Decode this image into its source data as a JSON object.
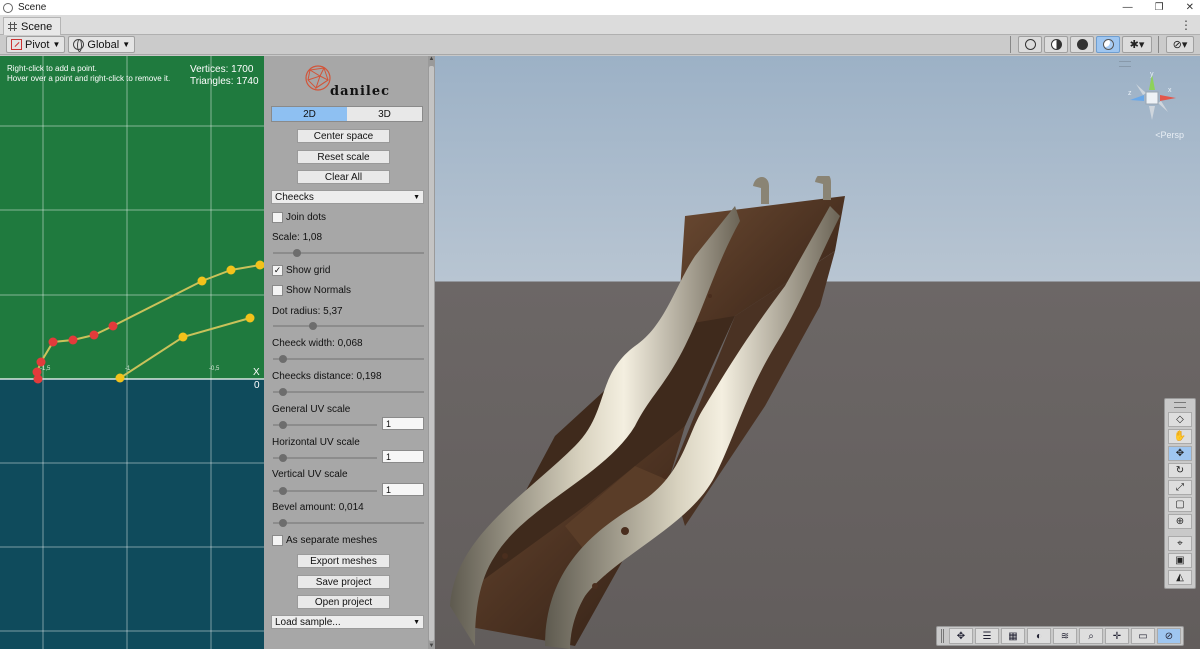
{
  "window": {
    "title": "Scene",
    "controls": [
      "—",
      "❐",
      "✕"
    ]
  },
  "tabs": [
    {
      "label": "Scene"
    }
  ],
  "toolbar": {
    "pivot_label": "Pivot",
    "global_label": "Global"
  },
  "graph": {
    "help_line1": "Right-click to add a point.",
    "help_line2": "Hover over a point and right-click to remove it.",
    "vertices": "Vertices: 1700",
    "triangles": "Triangles: 1740",
    "axis_x": "X",
    "axis_origin": "0",
    "tick_a": "-1,5",
    "tick_b": "-1",
    "tick_c": "-0,5",
    "colors": {
      "upper": "#1f7a3e",
      "lower": "#0f4b5c",
      "red_dot": "#e23b3b",
      "yellow_dot": "#f2c21b"
    }
  },
  "panel": {
    "logo": "danilec",
    "mode_2d": "2D",
    "mode_3d": "3D",
    "center_space": "Center space",
    "reset_scale": "Reset scale",
    "clear_all": "Clear All",
    "preset": "Cheecks",
    "join_dots": "Join dots",
    "join_dots_checked": false,
    "scale": "Scale: 1,08",
    "show_grid": "Show grid",
    "show_grid_checked": true,
    "show_normals": "Show Normals",
    "show_normals_checked": false,
    "dot_radius": "Dot radius: 5,37",
    "cheeck_width": "Cheeck width: 0,068",
    "cheecks_distance": "Cheecks distance: 0,198",
    "general_uv": "General UV scale",
    "general_uv_value": "1",
    "horizontal_uv": "Horizontal UV scale",
    "horizontal_uv_value": "1",
    "vertical_uv": "Vertical UV scale",
    "vertical_uv_value": "1",
    "bevel": "Bevel amount: 0,014",
    "separate_meshes": "As separate meshes",
    "separate_meshes_checked": false,
    "export_meshes": "Export meshes",
    "save_project": "Save project",
    "open_project": "Open project",
    "load_sample": "Load sample..."
  },
  "viewport": {
    "persp_label": "<Persp",
    "gizmo_y": "y",
    "gizmo_x": "x",
    "gizmo_z": "z"
  }
}
